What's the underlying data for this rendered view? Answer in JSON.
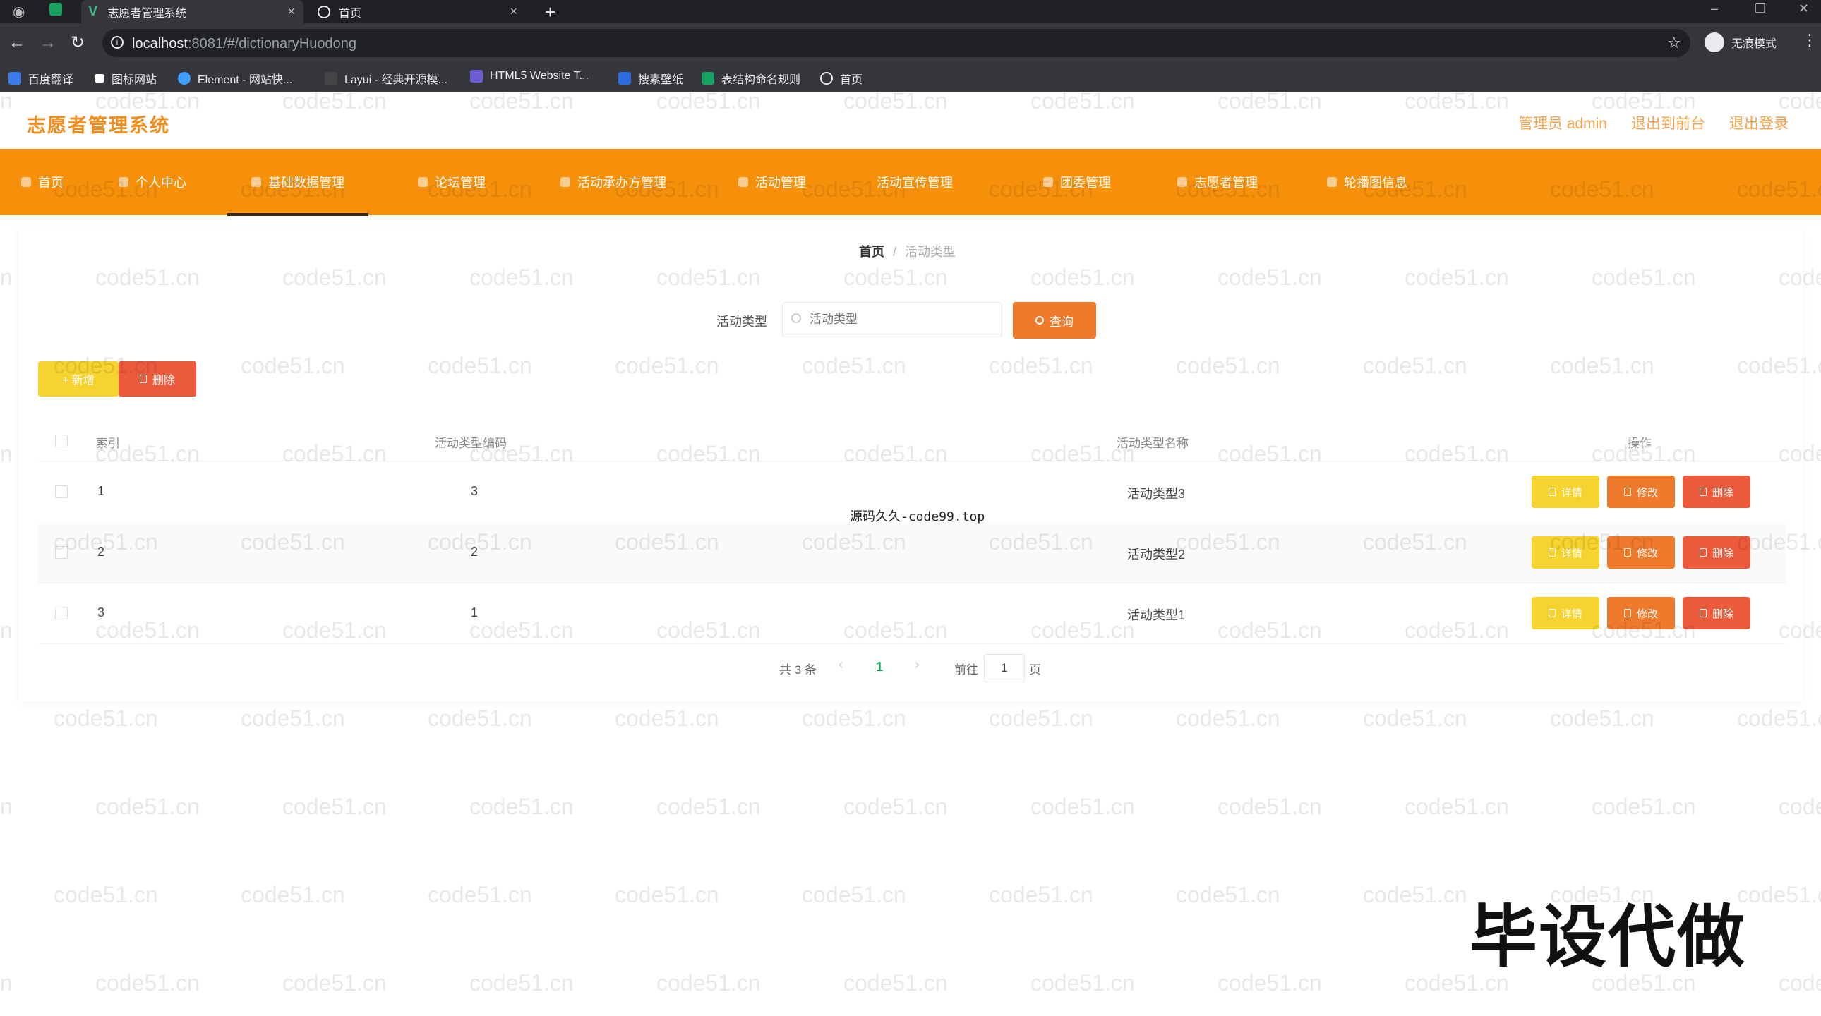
{
  "browser": {
    "tabs": [
      {
        "title": "志愿者管理系统",
        "active": true
      },
      {
        "title": "首页",
        "active": false
      }
    ],
    "url_host": "localhost",
    "url_path": ":8081/#/dictionaryHuodong",
    "profile_label": "无痕模式",
    "bookmarks": [
      "百度翻译",
      "图标网站",
      "Element - 网站快...",
      "Layui - 经典开源模...",
      "HTML5 Website T...",
      "搜素壁纸",
      "表结构命名规则",
      "首页"
    ]
  },
  "header": {
    "app_title": "志愿者管理系统",
    "admin_label": "管理员 admin",
    "frontend_link": "退出到前台",
    "logout_link": "退出登录"
  },
  "nav": {
    "items": [
      "首页",
      "个人中心",
      "基础数据管理",
      "论坛管理",
      "活动承办方管理",
      "活动管理",
      "活动宣传管理",
      "团委管理",
      "志愿者管理",
      "轮播图信息"
    ],
    "active_index": 2
  },
  "breadcrumb": {
    "home": "首页",
    "sep": "/",
    "current": "活动类型"
  },
  "search": {
    "label": "活动类型",
    "placeholder": "活动类型",
    "button": "查询"
  },
  "toolbar": {
    "add": "+ 新增",
    "delete": "删除"
  },
  "table": {
    "headers": [
      "索引",
      "活动类型编码",
      "活动类型名称",
      "操作"
    ],
    "rows": [
      {
        "index": "1",
        "code": "3",
        "name": "活动类型3"
      },
      {
        "index": "2",
        "code": "2",
        "name": "活动类型2"
      },
      {
        "index": "3",
        "code": "1",
        "name": "活动类型1"
      }
    ],
    "actions": {
      "detail": "详情",
      "edit": "修改",
      "remove": "删除"
    }
  },
  "pagination": {
    "total": "共 3 条",
    "current_page": "1",
    "goto_label": "前往",
    "goto_value": "1",
    "page_suffix": "页"
  },
  "overlay": {
    "source_text": "源码久久-code99.top",
    "watermark": "code51.cn",
    "stamp": "毕设代做"
  },
  "colors": {
    "nav_bg": "#f6900b",
    "title": "#f28c1a",
    "detail_btn": "#f6d32f",
    "edit_btn": "#f07a2b",
    "remove_btn": "#ec5a3c",
    "page_current": "#19a25d"
  }
}
